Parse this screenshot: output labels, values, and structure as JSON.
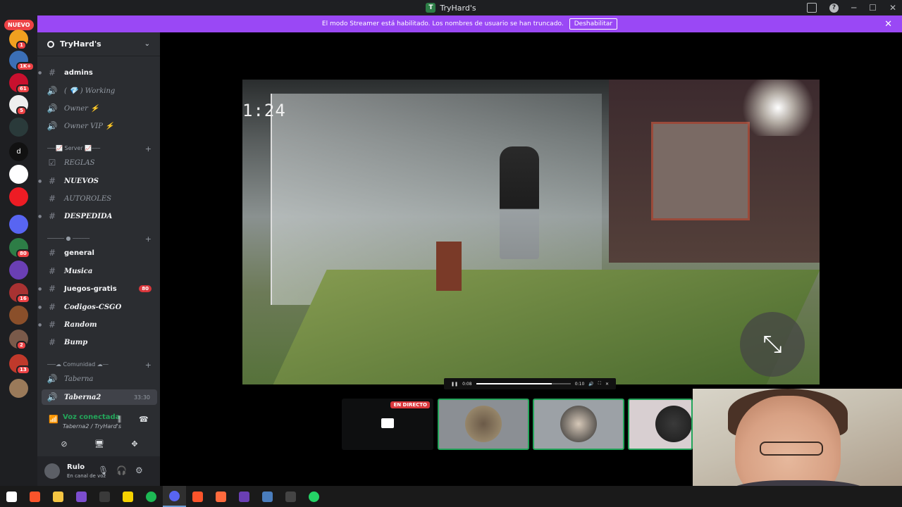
{
  "window": {
    "title": "TryHard's"
  },
  "rail": {
    "nuevo_label": "NUEVO",
    "servers": [
      {
        "color": "#f0a020",
        "badge": "1"
      },
      {
        "color": "#3b6fb6",
        "badge": "1K+"
      },
      {
        "color": "#c8102e",
        "badge": "61"
      },
      {
        "color": "#eeeeee",
        "badge": "5"
      },
      {
        "color": "#2a3a3a",
        "badge": ""
      },
      {
        "color": "#111111",
        "badge": "",
        "letter": "d"
      },
      {
        "color": "#ffffff",
        "badge": ""
      },
      {
        "color": "#ed1c24",
        "badge": ""
      },
      {
        "color": "#5865f2",
        "badge": ""
      },
      {
        "color": "#2d7d46",
        "badge": "80"
      },
      {
        "color": "#6a3fb4",
        "badge": ""
      },
      {
        "color": "#a83232",
        "badge": "16"
      },
      {
        "color": "#8a4f2a",
        "badge": ""
      },
      {
        "color": "#7a5a4a",
        "badge": "2"
      },
      {
        "color": "#c0392b",
        "badge": "13"
      },
      {
        "color": "#9a7a5a",
        "badge": ""
      }
    ],
    "letter_d": "d"
  },
  "banner": {
    "text": "El modo Streamer está habilitado. Los nombres de usuario se han truncado.",
    "button": "Deshabilitar"
  },
  "server": {
    "name": "TryHard's",
    "header_name": "TryHard's"
  },
  "channels": {
    "admins": "admins",
    "working": "( 💎 )  Working",
    "owner": "Owner ⚡",
    "owner_vip": "Owner VIP ⚡",
    "cat_server": "⎯⎯⎯📈 Server 📈⎯⎯⎯",
    "reglas": "REGLAS",
    "nuevos": "NUEVOS",
    "autoroles": "AUTOROLES",
    "despedida": "DESPEDIDA",
    "general": "general",
    "musica": "Musica",
    "juegos": "Juegos-gratis",
    "juegos_badge": "80",
    "codigos": "Codigos-CSGO",
    "random": "Random",
    "bump": "Bump",
    "cat_comunidad": "⎯⎯⎯☁ Comunidad ☁⎯⎯",
    "taberna": "Taberna",
    "taberna2": "Taberna2",
    "taberna2_time": "33:30"
  },
  "voice": {
    "title": "Voz conectada",
    "sub": "Taberna2 / TryHard's"
  },
  "user": {
    "name": "Rulo",
    "status": "En canal de voz"
  },
  "player": {
    "current": "0:08",
    "total": "0:10",
    "progress": 0.8,
    "timestamp": "1:24"
  },
  "tiles": {
    "live_label": "EN DIRECTO"
  },
  "taskbar": {
    "apps": [
      "windows-icon",
      "brave-icon",
      "files-icon",
      "vs-icon",
      "terminal-icon",
      "notes-icon",
      "spotify-icon",
      "discord-icon",
      "brave2-icon",
      "edit-icon",
      "media-icon",
      "db-icon",
      "obs-icon",
      "whatsapp-icon"
    ],
    "colors": [
      "#ffffff",
      "#fb542b",
      "#f4c542",
      "#7c4dce",
      "#3a3a3a",
      "#f5d200",
      "#1db954",
      "#5865f2",
      "#fb542b",
      "#ff6a3d",
      "#6a3fb4",
      "#4a7dbd",
      "#444444",
      "#25d366"
    ]
  }
}
